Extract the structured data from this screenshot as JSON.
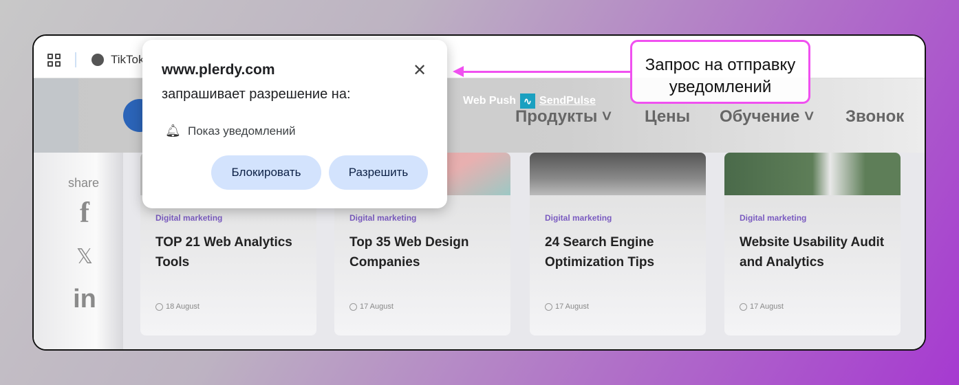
{
  "browser": {
    "tab_title": "TikTok"
  },
  "site": {
    "web_push": "Web Push",
    "sendpulse": "SendPulse",
    "nav": [
      "Продукты ˅",
      "Цены",
      "Обучение ˅",
      "Звонок"
    ],
    "share": "share",
    "cards": [
      {
        "category": "Digital marketing",
        "title": "TOP 21 Web Analytics Tools",
        "date": "18 August"
      },
      {
        "category": "Digital marketing",
        "title": "Top 35 Web Design Companies",
        "date": "17 August"
      },
      {
        "category": "Digital marketing",
        "title": "24 Search Engine Optimization Tips",
        "date": "17 August"
      },
      {
        "category": "Digital marketing",
        "title": "Website Usability Audit and Analytics",
        "date": "17 August"
      }
    ]
  },
  "popup": {
    "site": "www.plerdy.com",
    "request": "запрашивает разрешение на:",
    "permission": "Показ уведомлений",
    "block": "Блокировать",
    "allow": "Разрешить"
  },
  "callout": {
    "text": "Запрос на отправку уведомлений",
    "color": "#f050f0"
  }
}
